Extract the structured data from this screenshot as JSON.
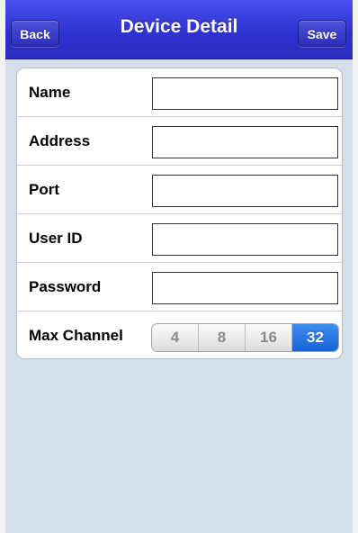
{
  "navbar": {
    "title": "Device Detail",
    "back_label": "Back",
    "save_label": "Save"
  },
  "form": {
    "fields": [
      {
        "label": "Name",
        "value": ""
      },
      {
        "label": "Address",
        "value": ""
      },
      {
        "label": "Port",
        "value": ""
      },
      {
        "label": "User ID",
        "value": ""
      },
      {
        "label": "Password",
        "value": ""
      }
    ],
    "max_channel": {
      "label": "Max Channel",
      "options": [
        "4",
        "8",
        "16",
        "32"
      ],
      "selected": "32"
    }
  },
  "colors": {
    "navbar": "#3337d6",
    "background": "#d5dfe9",
    "selected_segment": "#1f6fe0"
  }
}
